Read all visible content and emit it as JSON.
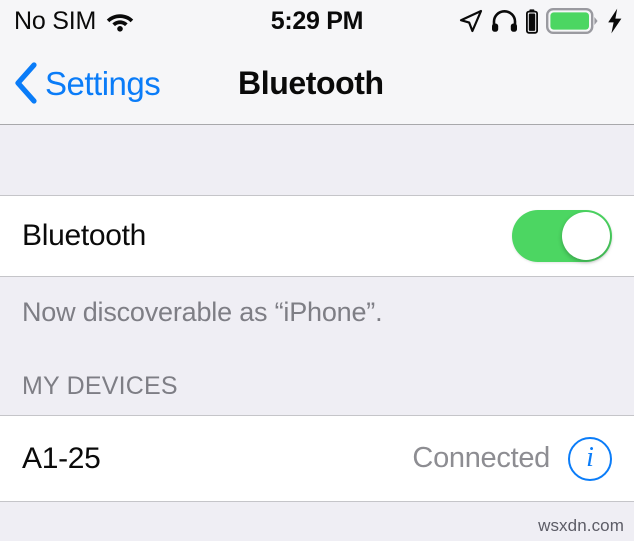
{
  "status_bar": {
    "carrier": "No SIM",
    "wifi_icon": "wifi-icon",
    "time": "5:29 PM",
    "location_icon": "location-arrow-icon",
    "headphones_icon": "headphones-icon",
    "headphones_battery_icon": "headphones-battery-icon",
    "battery_icon": "battery-icon",
    "charging_icon": "lightning-bolt-icon",
    "battery_level_percent": 100,
    "battery_color": "#4cd662"
  },
  "nav_bar": {
    "back_label": "Settings",
    "back_icon": "chevron-left-icon",
    "title": "Bluetooth"
  },
  "bluetooth_section": {
    "label": "Bluetooth",
    "toggle_on": true,
    "toggle_on_color": "#4cd662",
    "footer_text": "Now discoverable as “iPhone”."
  },
  "devices_section": {
    "header": "MY DEVICES",
    "devices": [
      {
        "name": "A1-25",
        "status": "Connected",
        "info_icon": "info-circle-icon",
        "info_icon_color": "#0a7cf8"
      }
    ]
  },
  "watermark": {
    "text": "wsxdn.com"
  },
  "theme": {
    "accent_blue": "#0a7cf8",
    "background_gray": "#efeef4",
    "row_white": "#ffffff",
    "secondary_text": "#8d8d92"
  }
}
